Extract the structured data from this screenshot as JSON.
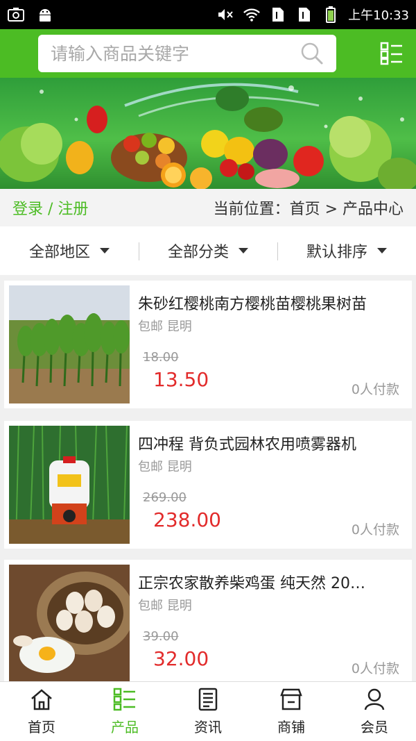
{
  "status_bar": {
    "time": "上午10:33",
    "icons": [
      "screenshot-icon",
      "android-icon",
      "mute-icon",
      "wifi-icon",
      "sim1-icon",
      "sim2-icon",
      "battery-icon"
    ]
  },
  "header": {
    "search_placeholder": "请输入商品关键字",
    "accent_color": "#4cbc24"
  },
  "breadcrumb": {
    "login": "登录 / 注册",
    "location": "当前位置：首页 > 产品中心"
  },
  "filters": [
    {
      "label": "全部地区"
    },
    {
      "label": "全部分类"
    },
    {
      "label": "默认排序"
    }
  ],
  "products": [
    {
      "title": "朱砂红樱桃南方樱桃苗樱桃果树苗",
      "meta": "包邮 昆明",
      "old_price": "18.00",
      "price": "13.50",
      "sold": "0人付款"
    },
    {
      "title": "四冲程 背负式园林农用喷雾器机",
      "meta": "包邮 昆明",
      "old_price": "269.00",
      "price": "238.00",
      "sold": "0人付款"
    },
    {
      "title": "正宗农家散养柴鸡蛋 纯天然 20…",
      "meta": "包邮 昆明",
      "old_price": "39.00",
      "price": "32.00",
      "sold": "0人付款"
    }
  ],
  "bottom_nav": [
    {
      "label": "首页",
      "icon": "home-icon"
    },
    {
      "label": "产品",
      "icon": "products-icon"
    },
    {
      "label": "资讯",
      "icon": "news-icon"
    },
    {
      "label": "商铺",
      "icon": "shop-icon"
    },
    {
      "label": "会员",
      "icon": "member-icon"
    }
  ]
}
